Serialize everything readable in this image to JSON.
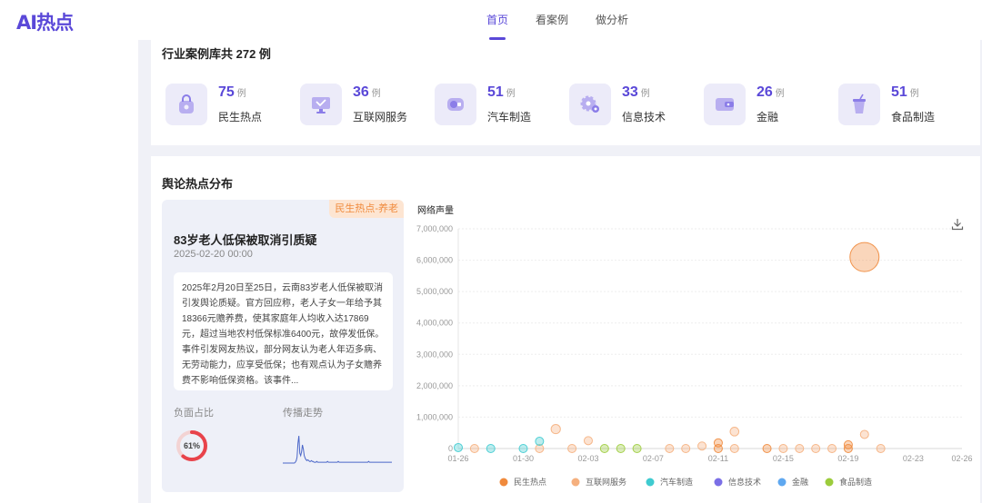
{
  "app": {
    "logo": "AI热点"
  },
  "nav": {
    "items": [
      "首页",
      "看案例",
      "做分析"
    ],
    "active": 0
  },
  "library": {
    "title": "行业案例库共 272 例",
    "unit": "例",
    "industries": [
      {
        "count": "75",
        "name": "民生热点",
        "icon": "shopping-bag-icon"
      },
      {
        "count": "36",
        "name": "互联网服务",
        "icon": "monitor-icon"
      },
      {
        "count": "51",
        "name": "汽车制造",
        "icon": "car-icon"
      },
      {
        "count": "33",
        "name": "信息技术",
        "icon": "gear-icon"
      },
      {
        "count": "26",
        "name": "金融",
        "icon": "wallet-icon"
      },
      {
        "count": "51",
        "name": "食品制造",
        "icon": "drink-icon"
      }
    ]
  },
  "distribution": {
    "title": "舆论热点分布",
    "event": {
      "tag": "民生热点-养老",
      "title": "83岁老人低保被取消引质疑",
      "date": "2025-02-20 00:00",
      "description": "2025年2月20日至25日，云南83岁老人低保被取消引发舆论质疑。官方回应称，老人子女一年给予其18366元赡养费，使其家庭年人均收入达17869元，超过当地农村低保标准6400元，故停发低保。事件引发网友热议，部分网友认为老人年迈多病、无劳动能力，应享受低保；也有观点认为子女赡养费不影响低保资格。该事件...",
      "negative_label": "负面占比",
      "negative_ratio_text": "61%",
      "negative_ratio": 0.61,
      "trend_label": "传播走势",
      "trend": [
        0,
        0,
        0,
        0,
        0,
        0,
        0,
        0,
        0,
        0,
        0,
        0,
        0,
        0,
        1,
        3,
        7,
        24,
        33,
        12,
        9,
        14,
        22,
        17,
        9,
        6,
        4,
        3,
        4,
        3,
        2,
        2,
        3,
        2,
        2,
        1,
        1,
        1,
        2,
        1,
        1,
        1,
        1,
        1,
        1,
        1,
        1,
        1,
        1,
        1,
        2,
        1,
        1,
        1,
        1,
        1,
        1,
        1,
        1,
        1,
        1,
        1,
        2,
        1,
        1,
        1,
        1,
        1,
        1,
        1,
        1,
        1,
        1,
        1,
        1,
        1,
        1,
        1,
        1,
        1,
        1,
        1,
        1,
        1,
        1,
        1,
        1,
        1,
        1,
        1,
        1,
        1,
        1,
        1,
        1,
        1,
        2,
        1,
        1,
        1,
        1,
        1,
        1,
        1,
        1,
        1,
        1,
        1,
        1,
        1,
        1,
        1,
        1,
        1,
        1,
        1,
        1,
        1,
        1,
        1,
        1,
        1,
        1
      ]
    }
  },
  "colors": {
    "accent": "#5a48d8",
    "民生热点": "#f08a3c",
    "互联网服务": "#f5b07e",
    "汽车制造": "#3fcbd0",
    "信息技术": "#7b6fe6",
    "金融": "#5fa8f0",
    "食品制造": "#9ccc3c"
  },
  "chart_data": {
    "type": "scatter",
    "title": "",
    "ylabel": "网络声量",
    "xlabel": "",
    "x_ticks": [
      "01-26",
      "01-30",
      "02-03",
      "02-07",
      "02-11",
      "02-15",
      "02-19",
      "02-23",
      "02-26"
    ],
    "x_range": [
      "2025-01-26",
      "2025-02-26"
    ],
    "y_ticks": [
      "0",
      "1,000,000",
      "2,000,000",
      "3,000,000",
      "4,000,000",
      "5,000,000",
      "6,000,000",
      "7,000,000"
    ],
    "ylim": [
      0,
      7000000
    ],
    "legend_position": "bottom",
    "series": [
      {
        "name": "民生热点",
        "points": [
          {
            "x": "2025-02-11",
            "y": 0
          },
          {
            "x": "2025-02-11",
            "y": 180000
          },
          {
            "x": "2025-02-14",
            "y": 0
          },
          {
            "x": "2025-02-19",
            "y": 0
          },
          {
            "x": "2025-02-19",
            "y": 120000
          },
          {
            "x": "2025-02-20",
            "y": 6100000
          }
        ]
      },
      {
        "name": "互联网服务",
        "points": [
          {
            "x": "2025-01-27",
            "y": 0
          },
          {
            "x": "2025-01-31",
            "y": 0
          },
          {
            "x": "2025-02-01",
            "y": 620000
          },
          {
            "x": "2025-02-02",
            "y": 0
          },
          {
            "x": "2025-02-03",
            "y": 250000
          },
          {
            "x": "2025-02-08",
            "y": 0
          },
          {
            "x": "2025-02-09",
            "y": 0
          },
          {
            "x": "2025-02-10",
            "y": 80000
          },
          {
            "x": "2025-02-12",
            "y": 0
          },
          {
            "x": "2025-02-12",
            "y": 540000
          },
          {
            "x": "2025-02-15",
            "y": 0
          },
          {
            "x": "2025-02-16",
            "y": 0
          },
          {
            "x": "2025-02-17",
            "y": 0
          },
          {
            "x": "2025-02-18",
            "y": 0
          },
          {
            "x": "2025-02-20",
            "y": 450000
          },
          {
            "x": "2025-02-21",
            "y": 0
          }
        ]
      },
      {
        "name": "汽车制造",
        "points": [
          {
            "x": "2025-01-26",
            "y": 30000
          },
          {
            "x": "2025-01-28",
            "y": 0
          },
          {
            "x": "2025-01-30",
            "y": 0
          },
          {
            "x": "2025-01-31",
            "y": 230000
          }
        ]
      },
      {
        "name": "信息技术",
        "points": []
      },
      {
        "name": "金融",
        "points": []
      },
      {
        "name": "食品制造",
        "points": [
          {
            "x": "2025-02-04",
            "y": 0
          },
          {
            "x": "2025-02-05",
            "y": 0
          },
          {
            "x": "2025-02-06",
            "y": 0
          }
        ]
      }
    ]
  }
}
